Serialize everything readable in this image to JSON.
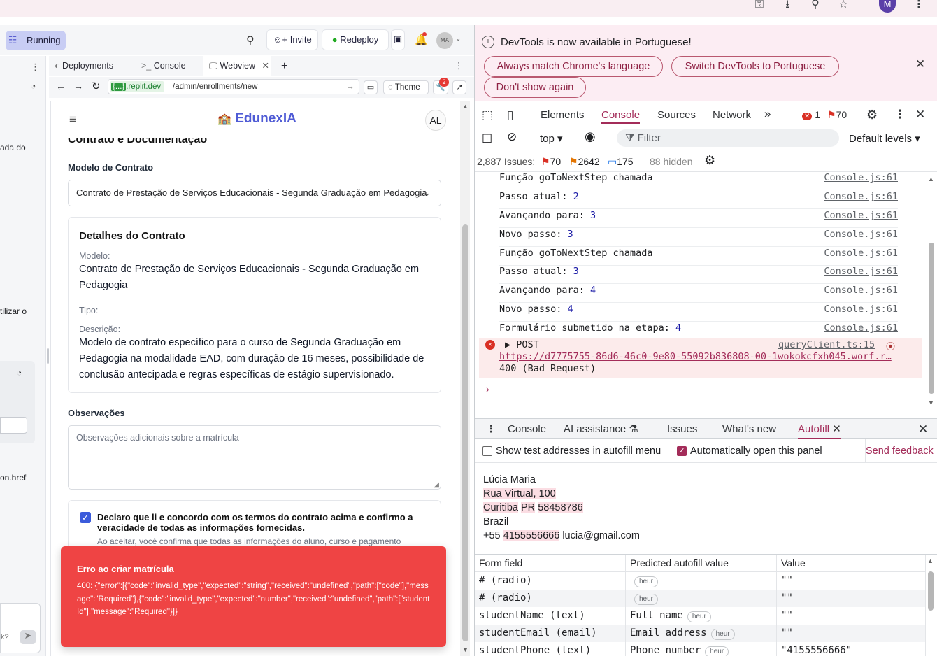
{
  "browser": {
    "profile_initial": "M"
  },
  "replit": {
    "status": "Running",
    "invite_label": "Invite",
    "redeploy_label": "Redeploy",
    "notification_count": "",
    "avatar_initials": "MA",
    "tabs": [
      {
        "label": "Deployments",
        "icon": "deploy-icon"
      },
      {
        "label": "Console",
        "icon": "terminal-icon"
      },
      {
        "label": "Webview",
        "icon": "monitor-icon"
      }
    ],
    "domain_chip": ".replit.dev",
    "domain_prefix": "{...}",
    "url_path": "/admin/enrollments/new",
    "theme_label": "Theme",
    "devtools_badge": "2",
    "left_pane_snippets": [
      "ada do",
      "tilizar o",
      "on.href",
      "k?"
    ]
  },
  "app": {
    "brand": "EdunexIA",
    "user_initials": "AL",
    "section_title_partial": "Contrato e Documentação",
    "contract_model_label": "Modelo de Contrato",
    "contract_model_value": "Contrato de Prestação de Serviços Educacionais - Segunda Graduação em Pedagogia",
    "details_title": "Detalhes do Contrato",
    "model_label": "Modelo:",
    "model_value": "Contrato de Prestação de Serviços Educacionais - Segunda Graduação em Pedagogia",
    "type_label": "Tipo:",
    "description_label": "Descrição:",
    "description_value": "Modelo de contrato específico para o curso de Segunda Graduação em Pedagogia na modalidade EAD, com duração de 16 meses, possibilidade de conclusão antecipada e regras específicas de estágio supervisionado.",
    "notes_label": "Observações",
    "notes_placeholder": "Observações adicionais sobre a matrícula",
    "agree_text": "Declaro que li e concordo com os termos do contrato acima e confirmo a veracidade de todas as informações fornecidas.",
    "agree_subtext": "Ao aceitar, você confirma que todas as informações do aluno, curso e pagamento",
    "toast_title": "Erro ao criar matrícula",
    "toast_body": "400: {\"error\":[{\"code\":\"invalid_type\",\"expected\":\"string\",\"received\":\"undefined\",\"path\":[\"code\"],\"message\":\"Required\"},{\"code\":\"invalid_type\",\"expected\":\"number\",\"received\":\"undefined\",\"path\":[\"studentId\"],\"message\":\"Required\"}]}"
  },
  "devtools": {
    "notice_text": "DevTools is now available in Portuguese!",
    "btn_always_match": "Always match Chrome's language",
    "btn_switch": "Switch DevTools to Portuguese",
    "btn_dont_show": "Don't show again",
    "tabs": [
      "Elements",
      "Console",
      "Sources",
      "Network"
    ],
    "active_tab": "Console",
    "error_count": "1",
    "warning_count": "70",
    "context": "top",
    "filter_placeholder": "Filter",
    "levels": "Default levels",
    "issues_label": "2,887 Issues:",
    "issues_errors": "70",
    "issues_warnings": "2642",
    "issues_info": "175",
    "hidden": "88 hidden",
    "logs": [
      {
        "text": "Função goToNextStep chamada",
        "num": "",
        "src": "Console.js:61"
      },
      {
        "text": "Passo atual: ",
        "num": "2",
        "src": "Console.js:61"
      },
      {
        "text": "Avançando para: ",
        "num": "3",
        "src": "Console.js:61"
      },
      {
        "text": "Novo passo: ",
        "num": "3",
        "src": "Console.js:61"
      },
      {
        "text": "Função goToNextStep chamada",
        "num": "",
        "src": "Console.js:61"
      },
      {
        "text": "Passo atual: ",
        "num": "3",
        "src": "Console.js:61"
      },
      {
        "text": "Avançando para: ",
        "num": "4",
        "src": "Console.js:61"
      },
      {
        "text": "Novo passo: ",
        "num": "4",
        "src": "Console.js:61"
      },
      {
        "text": "Formulário submetido na etapa: ",
        "num": "4",
        "src": "Console.js:61"
      }
    ],
    "error_method": "POST",
    "error_src": "queryClient.ts:15",
    "error_url": "https://d7775755-86d6-46c0-9e80-55092b836808-00-1wokokcfxh045.worf.r…",
    "error_status": "400 (Bad Request)",
    "drawer_tabs": [
      "Console",
      "AI assistance",
      "Issues",
      "What's new",
      "Autofill"
    ],
    "drawer_active": "Autofill",
    "opt_show_test": "Show test addresses in autofill menu",
    "opt_auto_open": "Automatically open this panel",
    "send_feedback": "Send feedback",
    "address": {
      "name": "Lúcia Maria",
      "street": "Rua Virtual, 100",
      "city": "Curitiba",
      "state": "PR",
      "zip": "58458786",
      "country": "Brazil",
      "phone_prefix": "+55",
      "phone": "4155556666",
      "email": "lucia@gmail.com"
    },
    "table_headers": [
      "Form field",
      "Predicted autofill value",
      "Value"
    ],
    "table_rows": [
      {
        "field": "# (radio)",
        "predicted": "",
        "heur": "heur",
        "value": "\"\""
      },
      {
        "field": "# (radio)",
        "predicted": "",
        "heur": "heur",
        "value": "\"\""
      },
      {
        "field": "studentName (text)",
        "predicted": "Full name",
        "heur": "heur",
        "value": "\"\""
      },
      {
        "field": "studentEmail (email)",
        "predicted": "Email address",
        "heur": "heur",
        "value": "\"\""
      },
      {
        "field": "studentPhone (text)",
        "predicted": "Phone number",
        "heur": "heur",
        "value": "\"4155556666\""
      }
    ]
  }
}
